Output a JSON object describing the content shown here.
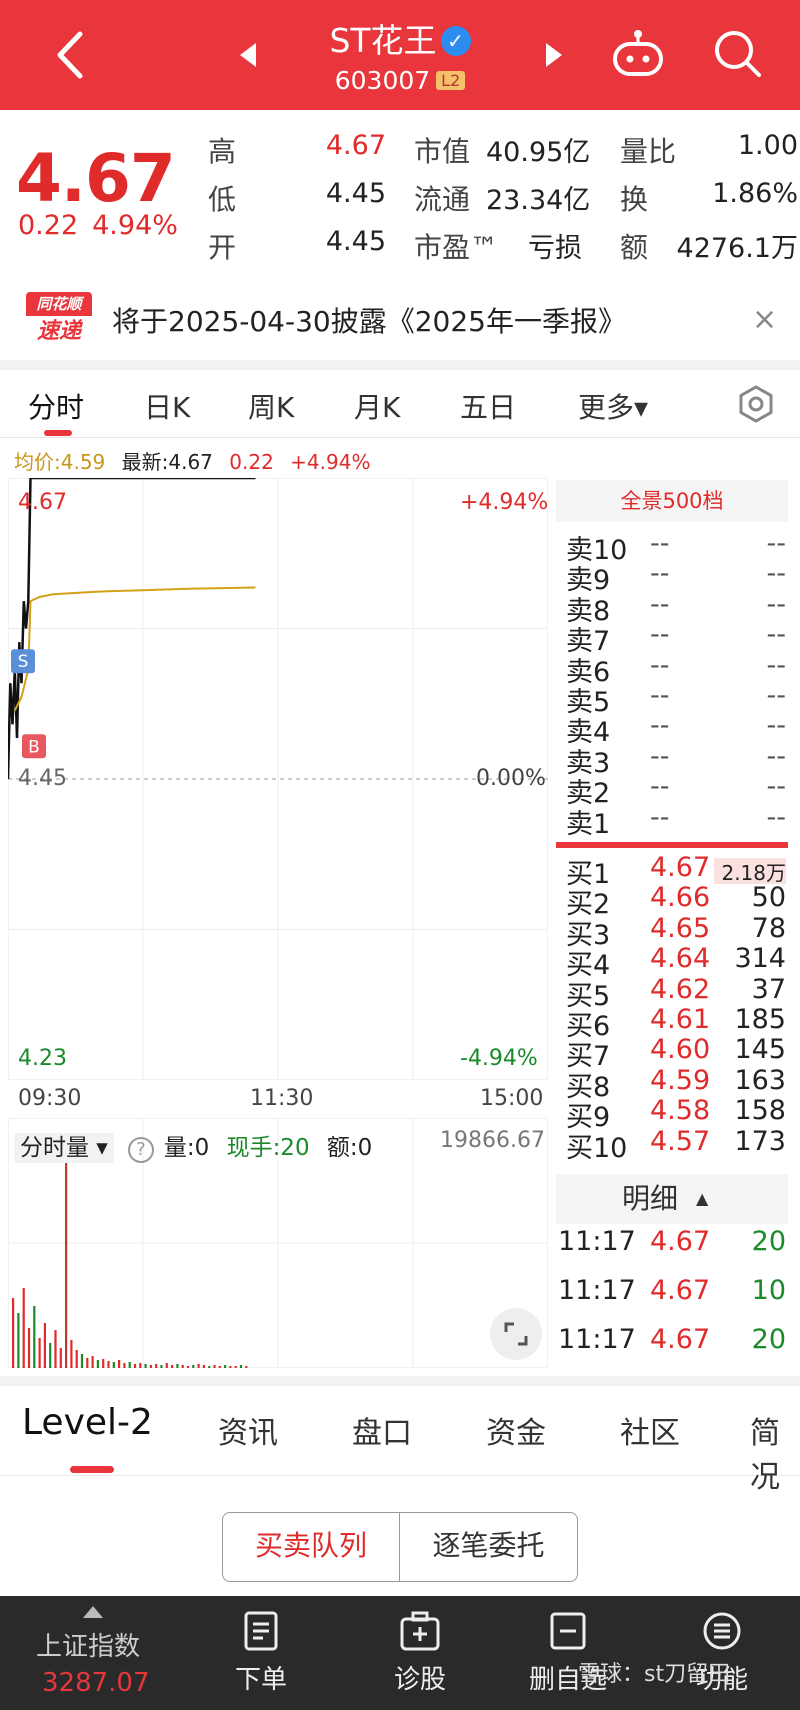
{
  "header": {
    "title": "ST花王",
    "verified_mark": "✓",
    "code": "603007",
    "badge": "L2"
  },
  "quote": {
    "price": "4.67",
    "change": "0.22",
    "change_pct": "4.94%",
    "high_label": "高",
    "high": "4.67",
    "low_label": "低",
    "low": "4.45",
    "open_label": "开",
    "open": "4.45",
    "mktcap_label": "市值",
    "mktcap": "40.95亿",
    "float_label": "流通",
    "float": "23.34亿",
    "pe_label": "市盈™",
    "pe": "亏损",
    "vol_ratio_label": "量比",
    "vol_ratio": "1.00",
    "turnover_label": "换",
    "turnover": "1.86%",
    "amount_label": "额",
    "amount": "4276.1万"
  },
  "notice": {
    "logo_top": "同花顺",
    "logo_bottom": "速递",
    "text": "将于2025-04-30披露《2025年一季报》",
    "close": "×"
  },
  "tabs": [
    "分时",
    "日K",
    "周K",
    "月K",
    "五日",
    "更多▾"
  ],
  "infoline": {
    "avg": "均价:4.59",
    "latest": "最新:4.67",
    "chg": "0.22",
    "pct": "+4.94%"
  },
  "chart_data": {
    "type": "line",
    "x_ticks": [
      "09:30",
      "11:30",
      "15:00"
    ],
    "y_left_ticks": [
      "4.67",
      "4.45",
      "4.23"
    ],
    "y_right_ticks": [
      "+4.94%",
      "0.00%",
      "-4.94%"
    ],
    "ylim": [
      4.23,
      4.67
    ],
    "series": [
      {
        "name": "最新",
        "color": "#111111",
        "x": [
          0,
          1,
          2,
          3,
          4,
          5,
          6,
          7,
          8,
          9,
          10,
          12,
          15,
          20,
          30,
          60,
          90,
          110
        ],
        "y": [
          4.45,
          4.52,
          4.49,
          4.53,
          4.48,
          4.55,
          4.52,
          4.58,
          4.56,
          4.58,
          4.67,
          4.67,
          4.67,
          4.67,
          4.67,
          4.67,
          4.67,
          4.67
        ]
      },
      {
        "name": "均价",
        "color": "#d4a017",
        "x": [
          3,
          6,
          9,
          10,
          14,
          20,
          40,
          80,
          110
        ],
        "y": [
          4.5,
          4.51,
          4.53,
          4.58,
          4.583,
          4.585,
          4.587,
          4.589,
          4.59
        ]
      }
    ],
    "markers": [
      {
        "label": "S",
        "color": "#5b8fd9"
      },
      {
        "label": "B",
        "color": "#e8595f"
      }
    ]
  },
  "volume": {
    "label": "分时量",
    "help": "?",
    "vol": "量:0",
    "hand": "现手:20",
    "amt": "额:0",
    "max": "19866.67"
  },
  "book": {
    "header": "全景500档",
    "sells": [
      {
        "label": "卖10",
        "price": "--",
        "vol": "--"
      },
      {
        "label": "卖9",
        "price": "--",
        "vol": "--"
      },
      {
        "label": "卖8",
        "price": "--",
        "vol": "--"
      },
      {
        "label": "卖7",
        "price": "--",
        "vol": "--"
      },
      {
        "label": "卖6",
        "price": "--",
        "vol": "--"
      },
      {
        "label": "卖5",
        "price": "--",
        "vol": "--"
      },
      {
        "label": "卖4",
        "price": "--",
        "vol": "--"
      },
      {
        "label": "卖3",
        "price": "--",
        "vol": "--"
      },
      {
        "label": "卖2",
        "price": "--",
        "vol": "--"
      },
      {
        "label": "卖1",
        "price": "--",
        "vol": "--"
      }
    ],
    "buys": [
      {
        "label": "买1",
        "price": "4.67",
        "vol": "2.18万"
      },
      {
        "label": "买2",
        "price": "4.66",
        "vol": "50"
      },
      {
        "label": "买3",
        "price": "4.65",
        "vol": "78"
      },
      {
        "label": "买4",
        "price": "4.64",
        "vol": "314"
      },
      {
        "label": "买5",
        "price": "4.62",
        "vol": "37"
      },
      {
        "label": "买6",
        "price": "4.61",
        "vol": "185"
      },
      {
        "label": "买7",
        "price": "4.60",
        "vol": "145"
      },
      {
        "label": "买8",
        "price": "4.59",
        "vol": "163"
      },
      {
        "label": "买9",
        "price": "4.58",
        "vol": "158"
      },
      {
        "label": "买10",
        "price": "4.57",
        "vol": "173"
      }
    ],
    "detail_header": "明细",
    "details": [
      {
        "time": "11:17",
        "price": "4.67",
        "vol": "20"
      },
      {
        "time": "11:17",
        "price": "4.67",
        "vol": "10"
      },
      {
        "time": "11:17",
        "price": "4.67",
        "vol": "20"
      }
    ]
  },
  "lower_tabs": [
    "Level-2",
    "资讯",
    "盘口",
    "资金",
    "社区",
    "简况"
  ],
  "segment": {
    "left": "买卖队列",
    "right": "逐笔委托"
  },
  "bottom": {
    "index_name": "上证指数",
    "index_value": "3287.07",
    "items": [
      "下单",
      "诊股",
      "删自选",
      "功能"
    ],
    "watermark": "雪球：st刀留田"
  },
  "colors": {
    "brand_red": "#e8363c",
    "up": "#e02b2b",
    "down": "#1a8a2b",
    "avg_line": "#d4a017"
  }
}
